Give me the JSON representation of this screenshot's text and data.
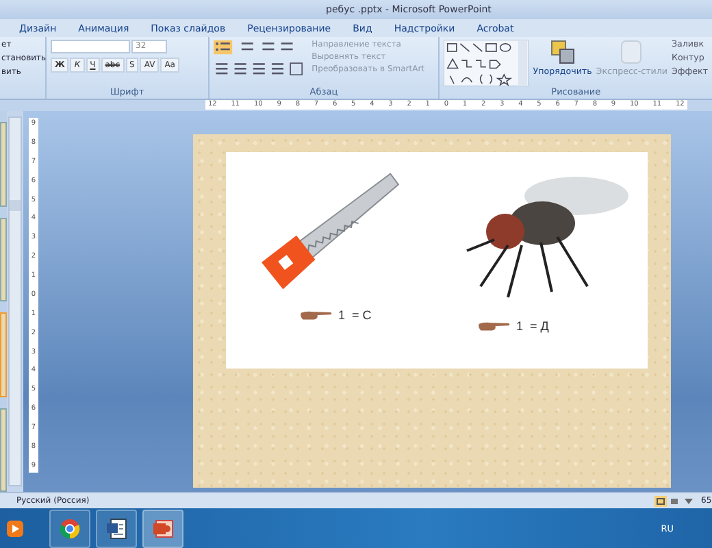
{
  "window": {
    "title": "ребус .pptx - Microsoft PowerPoint"
  },
  "tabs": [
    {
      "label": "Дизайн"
    },
    {
      "label": "Анимация"
    },
    {
      "label": "Показ слайдов"
    },
    {
      "label": "Рецензирование"
    },
    {
      "label": "Вид"
    },
    {
      "label": "Надстройки"
    },
    {
      "label": "Acrobat"
    }
  ],
  "ribbon": {
    "left_group": {
      "items": [
        "ет",
        "становить",
        "вить"
      ]
    },
    "font_group": {
      "label": "Шрифт",
      "size": "32",
      "buttons": [
        "Ж",
        "К",
        "Ч",
        "abc",
        "S",
        "AV",
        "Aa"
      ]
    },
    "paragraph_group": {
      "label": "Абзац",
      "commands": [
        "Направление текста",
        "Выровнять текст",
        "Преобразовать в SmartArt"
      ]
    },
    "drawing_group": {
      "label": "Рисование",
      "arrange": "Упорядочить",
      "quick_styles": "Экспресс-стили",
      "commands": [
        "Заливк",
        "Контур",
        "Эффект"
      ]
    }
  },
  "rulers": {
    "horizontal": [
      "12",
      "11",
      "10",
      "9",
      "8",
      "7",
      "6",
      "5",
      "4",
      "3",
      "2",
      "1",
      "0",
      "1",
      "2",
      "3",
      "4",
      "5",
      "6",
      "7",
      "8",
      "9",
      "10",
      "11",
      "12"
    ],
    "vertical": [
      "9",
      "8",
      "7",
      "6",
      "5",
      "4",
      "3",
      "2",
      "1",
      "0",
      "1",
      "2",
      "3",
      "4",
      "5",
      "6",
      "7",
      "8",
      "9"
    ]
  },
  "slide": {
    "clues": [
      {
        "formula": "1  = С"
      },
      {
        "formula": "1  = Д"
      }
    ]
  },
  "status_bar": {
    "language": "Русский (Россия)",
    "zoom": "65"
  },
  "taskbar": {
    "language": "RU"
  }
}
